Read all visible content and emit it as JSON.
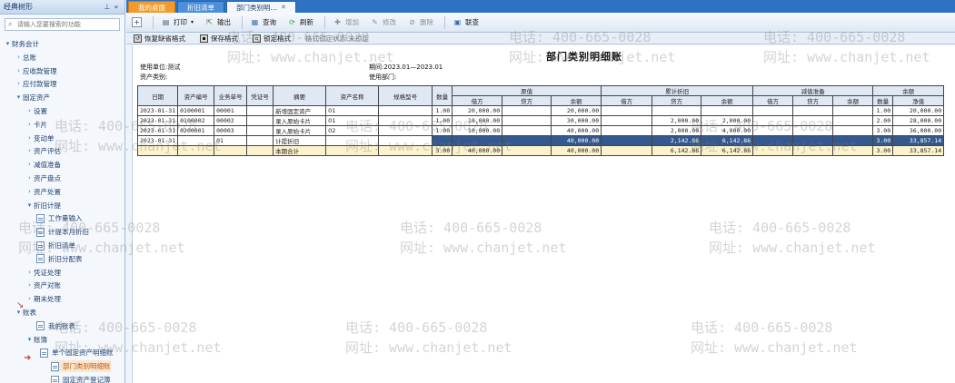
{
  "left_panel": {
    "title": "经典树形",
    "search_placeholder": "请输入您要搜索的功能",
    "items": [
      {
        "label": "财务会计",
        "arrow": "▾",
        "type": "folder"
      },
      {
        "label": "总账",
        "arrow": "›",
        "type": "folder"
      },
      {
        "label": "应收款管理",
        "arrow": "›",
        "type": "folder"
      },
      {
        "label": "应付款管理",
        "arrow": "›",
        "type": "folder"
      },
      {
        "label": "固定资产",
        "arrow": "▾",
        "type": "folder"
      },
      {
        "label": "设置",
        "arrow": "›",
        "type": "folder"
      },
      {
        "label": "卡片",
        "arrow": "›",
        "type": "folder"
      },
      {
        "label": "变动单",
        "arrow": "›",
        "type": "folder"
      },
      {
        "label": "资产评估",
        "arrow": "›",
        "type": "folder"
      },
      {
        "label": "减值准备",
        "arrow": "›",
        "type": "folder"
      },
      {
        "label": "资产盘点",
        "arrow": "›",
        "type": "folder"
      },
      {
        "label": "资产处置",
        "arrow": "›",
        "type": "folder"
      },
      {
        "label": "折旧计提",
        "arrow": "▾",
        "type": "folder"
      },
      {
        "label": "工作量输入",
        "arrow": "",
        "type": "doc"
      },
      {
        "label": "计提本月折旧",
        "arrow": "",
        "type": "doc"
      },
      {
        "label": "折旧清单",
        "arrow": "",
        "type": "doc"
      },
      {
        "label": "折旧分配表",
        "arrow": "",
        "type": "doc"
      },
      {
        "label": "凭证处理",
        "arrow": "›",
        "type": "folder"
      },
      {
        "label": "资产对账",
        "arrow": "›",
        "type": "folder"
      },
      {
        "label": "期末处理",
        "arrow": "›",
        "type": "folder"
      },
      {
        "label": "账表",
        "arrow": "▾",
        "type": "folder"
      },
      {
        "label": "我的账表",
        "arrow": "",
        "type": "doc"
      },
      {
        "label": "账簿",
        "arrow": "▾",
        "type": "folder"
      },
      {
        "label": "单个固定资产明细账",
        "arrow": "",
        "type": "doc"
      },
      {
        "label": "部门类别明细账",
        "arrow": "",
        "type": "doc",
        "selected": true
      },
      {
        "label": "固定资产登记簿",
        "arrow": "",
        "type": "doc"
      }
    ]
  },
  "tabs": [
    {
      "label": "我的桌面"
    },
    {
      "label": "折旧清单"
    },
    {
      "label": "部门类别明…",
      "active": true
    }
  ],
  "toolbar": {
    "new_icon": "+",
    "print": "打印",
    "export": "输出",
    "query": "查询",
    "refresh": "刷新",
    "add": "增加",
    "edit": "修改",
    "delete": "删除",
    "link_query": "联查"
  },
  "format_bar": {
    "restore": "恢复缺省格式",
    "save": "保存格式",
    "lock": "锁定格式",
    "status": "格式锁定状态:未锁定"
  },
  "report": {
    "title": "部门类别明细账",
    "unit": "使用单位:测试",
    "asset_type": "资产类别:",
    "period": "期间:2023.01—2023.01",
    "dept": "使用部门:",
    "headers": {
      "date": "日期",
      "asset_no": "资产编号",
      "biz_no": "业务单号",
      "voucher_no": "凭证号",
      "summary": "摘要",
      "asset_name": "资产名称",
      "spec": "规格型号",
      "qty": "数量",
      "original": "原值",
      "accum_dep": "累计折旧",
      "impairment": "减值准备",
      "balance": "余额",
      "debit": "借方",
      "credit": "贷方",
      "remain": "余额",
      "net": "净值"
    },
    "rows": [
      {
        "date": "2023-01-31",
        "asset_no": "0100001",
        "biz_no": "00001",
        "voucher": "",
        "summary": "新增固定资产",
        "name": "01",
        "spec": "",
        "qty": "1.00",
        "o_debit": "20,000.00",
        "o_credit": "",
        "o_bal": "20,000.00",
        "d_debit": "",
        "d_credit": "",
        "d_bal": "",
        "i_debit": "",
        "i_credit": "",
        "i_bal": "",
        "b_qty": "1.00",
        "b_net": "20,000.00"
      },
      {
        "date": "2023-01-31",
        "asset_no": "0100002",
        "biz_no": "00002",
        "voucher": "",
        "summary": "录入原始卡片",
        "name": "01",
        "spec": "",
        "qty": "1.00",
        "o_debit": "10,000.00",
        "o_credit": "",
        "o_bal": "30,000.00",
        "d_debit": "",
        "d_credit": "2,000.00",
        "d_bal": "2,000.00",
        "i_debit": "",
        "i_credit": "",
        "i_bal": "",
        "b_qty": "2.00",
        "b_net": "28,000.00"
      },
      {
        "date": "2023-01-31",
        "asset_no": "0200001",
        "biz_no": "00003",
        "voucher": "",
        "summary": "录入原始卡片",
        "name": "02",
        "spec": "",
        "qty": "1.00",
        "o_debit": "10,000.00",
        "o_credit": "",
        "o_bal": "40,000.00",
        "d_debit": "",
        "d_credit": "2,000.00",
        "d_bal": "4,000.00",
        "i_debit": "",
        "i_credit": "",
        "i_bal": "",
        "b_qty": "3.00",
        "b_net": "36,000.00"
      },
      {
        "date": "2023-01-31",
        "asset_no": "",
        "biz_no": "01",
        "voucher": "",
        "summary": "计提折旧",
        "name": "",
        "spec": "",
        "qty": "",
        "o_debit": "",
        "o_credit": "",
        "o_bal": "40,000.00",
        "d_debit": "",
        "d_credit": "2,142.86",
        "d_bal": "6,142.86",
        "i_debit": "",
        "i_credit": "",
        "i_bal": "",
        "b_qty": "3.00",
        "b_net": "33,857.14",
        "highlight": true
      },
      {
        "date": "",
        "asset_no": "",
        "biz_no": "",
        "voucher": "",
        "summary": "本期合计",
        "name": "",
        "spec": "",
        "qty": "3.00",
        "o_debit": "40,000.00",
        "o_credit": "",
        "o_bal": "40,000.00",
        "d_debit": "",
        "d_credit": "6,142.86",
        "d_bal": "6,142.86",
        "i_debit": "",
        "i_credit": "",
        "i_bal": "",
        "b_qty": "3.00",
        "b_net": "33,857.14",
        "total": true
      }
    ]
  },
  "watermark": {
    "phone": "电话: 400-665-0028",
    "site": "网址: www.chanjet.net"
  }
}
